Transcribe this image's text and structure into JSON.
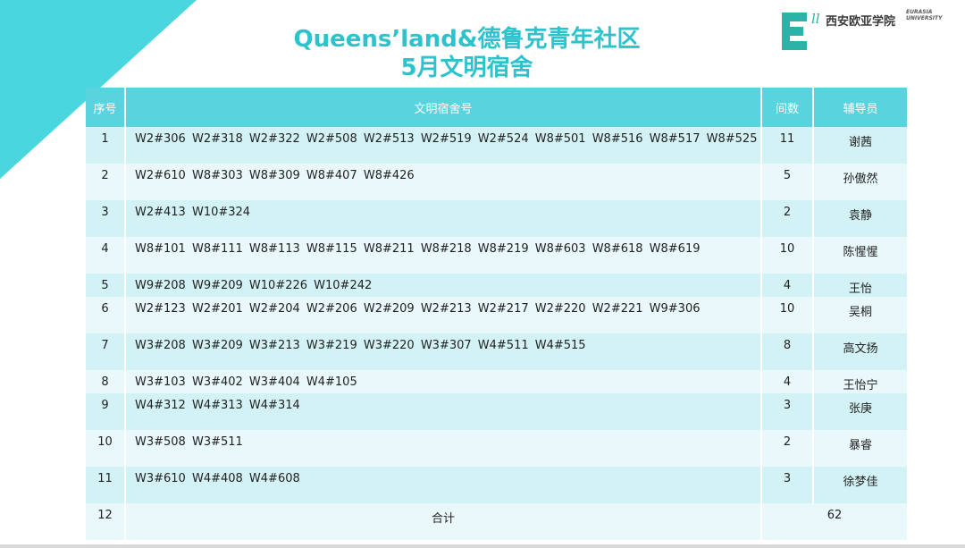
{
  "title": {
    "line1": "Queens’land&德鲁克青年社区",
    "line2": "5月文明宿舍"
  },
  "logo": {
    "mark_letter": "E",
    "chinese_name": "西安欧亚学院",
    "english_line1": "EURASIA",
    "english_line2": "UNIVERSITY"
  },
  "table": {
    "headers": [
      "序号",
      "文明宿舍号",
      "间数",
      "辅导员"
    ],
    "rows": [
      {
        "no": "1",
        "rooms": "W2#306  W2#318  W2#322  W2#508  W2#513  W2#519  W2#524  W8#501  W8#516  W8#517  W8#525",
        "count": "11",
        "tutor": "谢茜"
      },
      {
        "no": "2",
        "rooms": "W2#610  W8#303  W8#309  W8#407  W8#426",
        "count": "5",
        "tutor": "孙傲然"
      },
      {
        "no": "3",
        "rooms": "W2#413  W10#324",
        "count": "2",
        "tutor": "袁静"
      },
      {
        "no": "4",
        "rooms": "W8#101  W8#111  W8#113  W8#115  W8#211  W8#218  W8#219  W8#603  W8#618  W8#619",
        "count": "10",
        "tutor": "陈惺惺"
      },
      {
        "no": "5",
        "rooms": "W9#208  W9#209  W10#226  W10#242",
        "count": "4",
        "tutor": "王怡"
      },
      {
        "no": "6",
        "rooms": "W2#123  W2#201  W2#204  W2#206  W2#209  W2#213  W2#217  W2#220  W2#221  W9#306",
        "count": "10",
        "tutor": "吴桐"
      },
      {
        "no": "7",
        "rooms": "W3#208  W3#209  W3#213  W3#219  W3#220  W3#307  W4#511  W4#515",
        "count": "8",
        "tutor": "高文扬"
      },
      {
        "no": "8",
        "rooms": "W3#103  W3#402  W3#404  W4#105",
        "count": "4",
        "tutor": "王怡宁"
      },
      {
        "no": "9",
        "rooms": "W4#312  W4#313  W4#314",
        "count": "3",
        "tutor": "张庚"
      },
      {
        "no": "10",
        "rooms": "W3#508  W3#511",
        "count": "2",
        "tutor": "暴睿"
      },
      {
        "no": "11",
        "rooms": "W3#610  W4#408  W4#608",
        "count": "3",
        "tutor": "徐梦佳"
      }
    ],
    "total": {
      "no": "12",
      "label": "合计",
      "value": "62"
    }
  },
  "colors": {
    "accent": "#49d6de",
    "title": "#2ec3cc",
    "header_bg": "#59d4df",
    "row_odd": "#d2f2f5",
    "row_even": "#e9f8fa",
    "logo_green": "#2bb3a8"
  }
}
